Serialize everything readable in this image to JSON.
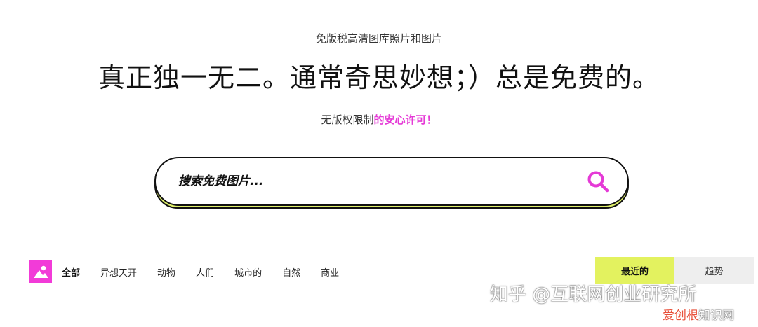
{
  "hero": {
    "subtitle": "免版税高清图库照片和图片",
    "headline": "真正独一无二。通常奇思妙想；）总是免费的。",
    "license_prefix": "无版权限制",
    "license_accent": "的安心许可！"
  },
  "search": {
    "placeholder": "搜索免费图片..."
  },
  "nav": {
    "items": [
      "全部",
      "异想天开",
      "动物",
      "人们",
      "城市的",
      "自然",
      "商业"
    ]
  },
  "sort": {
    "tabs": [
      "最近的",
      "趋势"
    ]
  },
  "watermark": {
    "main": "知乎 @互联网创业研究所",
    "sub_accent": "爱创根",
    "sub_rest": "知识网"
  },
  "colors": {
    "accent_pink": "#e53ad6",
    "logo_pink": "#f23bd8",
    "accent_lime": "#e3f25f"
  },
  "icons": {
    "search": "search-icon",
    "logo": "image-logo-icon"
  }
}
